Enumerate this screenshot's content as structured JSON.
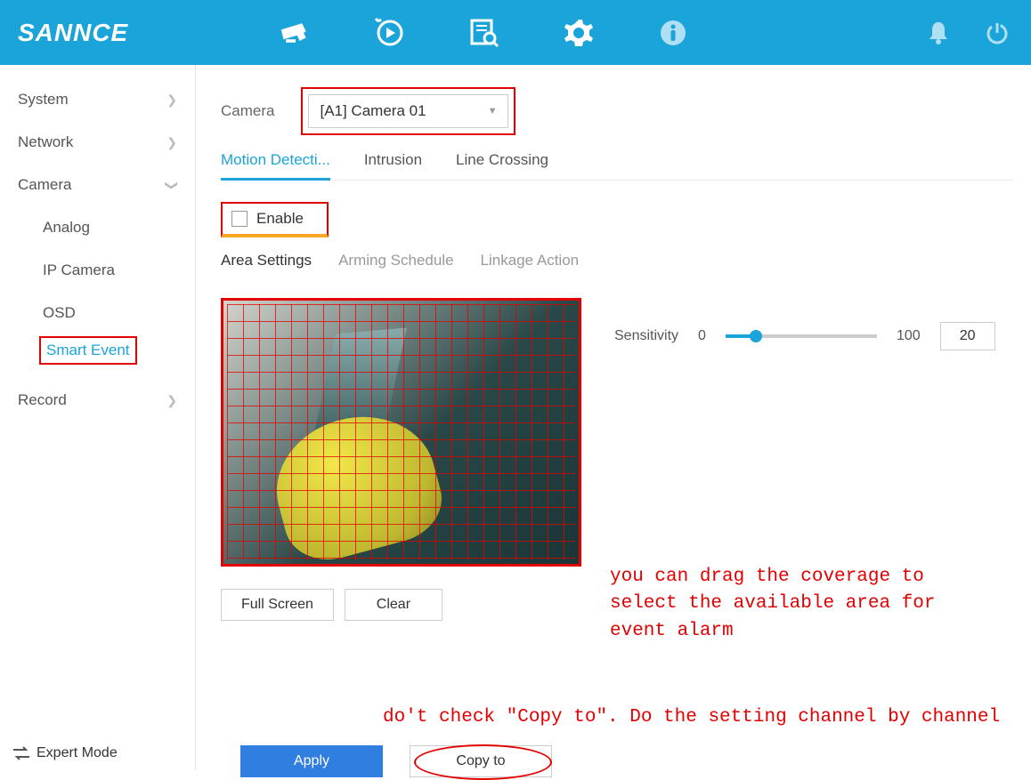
{
  "brand": "SANNCE",
  "topbar": {
    "icons": [
      "camera-icon",
      "playback-icon",
      "search-icon",
      "settings-icon",
      "info-icon",
      "bell-icon",
      "power-icon"
    ]
  },
  "sidebar": {
    "items": [
      {
        "label": "System",
        "expanded": false
      },
      {
        "label": "Network",
        "expanded": false
      },
      {
        "label": "Camera",
        "expanded": true,
        "children": [
          {
            "label": "Analog"
          },
          {
            "label": "IP Camera"
          },
          {
            "label": "OSD"
          },
          {
            "label": "Smart Event",
            "active": true
          }
        ]
      },
      {
        "label": "Record",
        "expanded": false
      }
    ],
    "expert_mode": "Expert Mode"
  },
  "main": {
    "camera_label": "Camera",
    "camera_value": "[A1] Camera 01",
    "tabs": [
      "Motion Detecti...",
      "Intrusion",
      "Line Crossing"
    ],
    "active_tab": 0,
    "enable_label": "Enable",
    "enable_checked": false,
    "subtabs": [
      "Area Settings",
      "Arming Schedule",
      "Linkage Action"
    ],
    "active_subtab": 0,
    "sensitivity_label": "Sensitivity",
    "sensitivity_min": "0",
    "sensitivity_max": "100",
    "sensitivity_value": "20",
    "fullscreen_btn": "Full Screen",
    "clear_btn": "Clear",
    "apply_btn": "Apply",
    "copyto_btn": "Copy to"
  },
  "annotations": {
    "coverage_note": "you can drag the coverage to select the available area for event alarm",
    "copyto_note": "do't check \"Copy to\". Do the setting channel by channel"
  }
}
